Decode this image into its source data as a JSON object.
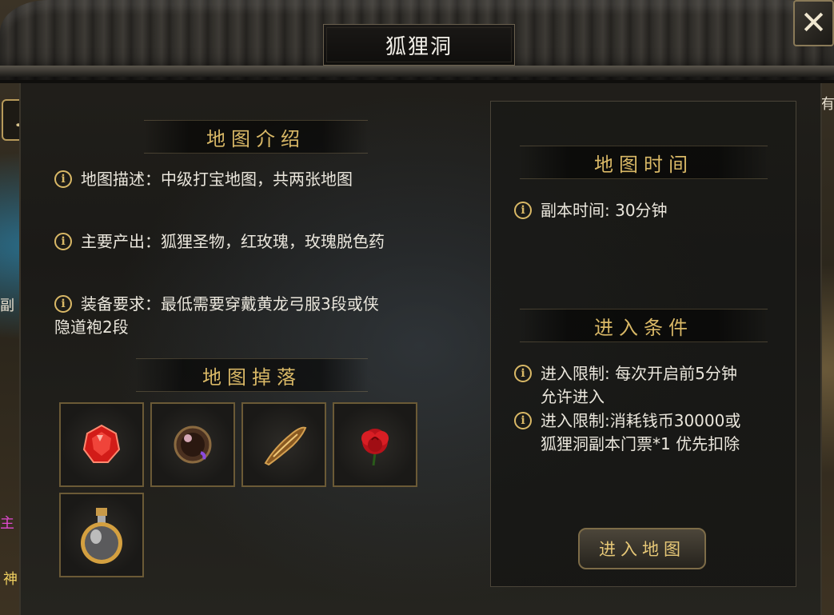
{
  "title": "狐狸洞",
  "close_icon": "close-icon",
  "left_section": {
    "intro_title": "地图介绍",
    "items": [
      {
        "icon": "info-icon",
        "text": "地图描述：中级打宝地图，共两张地图"
      },
      {
        "icon": "info-icon",
        "text": "主要产出：狐狸圣物，红玫瑰，玫瑰脱色药"
      },
      {
        "icon": "info-icon",
        "line1": "装备要求：最低需要穿戴黄龙弓服3段或侠",
        "line2": "隐道袍2段"
      }
    ],
    "drops_title": "地图掉落",
    "drops": [
      {
        "icon": "red-gem-icon"
      },
      {
        "icon": "purple-orb-icon"
      },
      {
        "icon": "golden-relic-icon"
      },
      {
        "icon": "red-rose-icon"
      },
      {
        "icon": "potion-bottle-icon"
      }
    ]
  },
  "right_section": {
    "time_title": "地图时间",
    "time_text": "副本时间: 30分钟",
    "conditions_title": "进入条件",
    "conditions": [
      {
        "line1": "进入限制: 每次开启前5分钟",
        "line2": "允许进入"
      },
      {
        "line1": "进入限制:消耗钱币30000或",
        "line2": "狐狸洞副本门票*1 优先扣除"
      }
    ],
    "enter_button": "进入地图"
  },
  "world": {
    "left_text_1": "副",
    "left_text_2": "主",
    "left_text_3": "神",
    "right_text": "有"
  },
  "colors": {
    "accent_gold": "#d9b866",
    "text": "#eae6dc",
    "panel_bg": "#1f1d19"
  }
}
